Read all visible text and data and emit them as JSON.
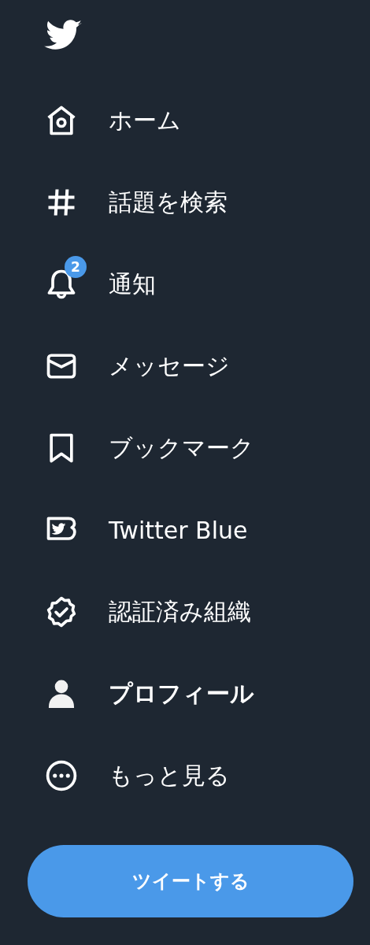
{
  "nav": {
    "items": [
      {
        "kind": "home",
        "label": "ホーム",
        "selected": false
      },
      {
        "kind": "hashtag",
        "label": "話題を検索",
        "selected": false
      },
      {
        "kind": "bell",
        "label": "通知",
        "selected": false,
        "badge": "2"
      },
      {
        "kind": "mail",
        "label": "メッセージ",
        "selected": false
      },
      {
        "kind": "bookmark",
        "label": "ブックマーク",
        "selected": false
      },
      {
        "kind": "blue",
        "label": "Twitter Blue",
        "selected": false
      },
      {
        "kind": "verified",
        "label": "認証済み組織",
        "selected": false
      },
      {
        "kind": "person",
        "label": "プロフィール",
        "selected": true
      },
      {
        "kind": "more",
        "label": "もっと見る",
        "selected": false
      }
    ]
  },
  "tweet_button": {
    "label": "ツイートする"
  }
}
